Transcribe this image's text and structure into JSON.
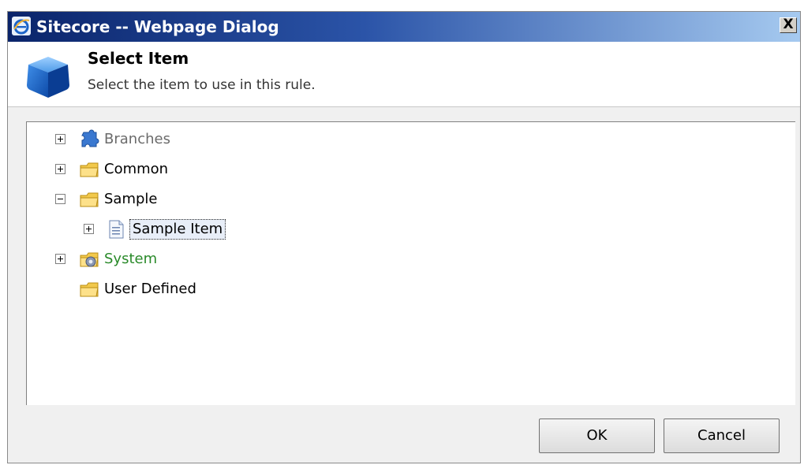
{
  "window": {
    "title": "Sitecore -- Webpage Dialog",
    "close_glyph": "X"
  },
  "header": {
    "title": "Select Item",
    "subtitle": "Select the item to use in this rule."
  },
  "tree": {
    "items": [
      {
        "label": "Branches",
        "icon": "branches-icon",
        "expander": "plus",
        "color": "#6b6b6b"
      },
      {
        "label": "Common",
        "icon": "folder-icon",
        "expander": "plus",
        "color": "#000000"
      },
      {
        "label": "Sample",
        "icon": "folder-icon",
        "expander": "minus",
        "color": "#000000"
      },
      {
        "label": "Sample Item",
        "icon": "document-icon",
        "expander": "plus",
        "color": "#000000",
        "selected": true
      },
      {
        "label": "System",
        "icon": "system-folder-icon",
        "expander": "plus",
        "color": "#2a8a2a"
      },
      {
        "label": "User Defined",
        "icon": "folder-icon",
        "expander": "none",
        "color": "#000000"
      }
    ]
  },
  "buttons": {
    "ok": "OK",
    "cancel": "Cancel"
  }
}
